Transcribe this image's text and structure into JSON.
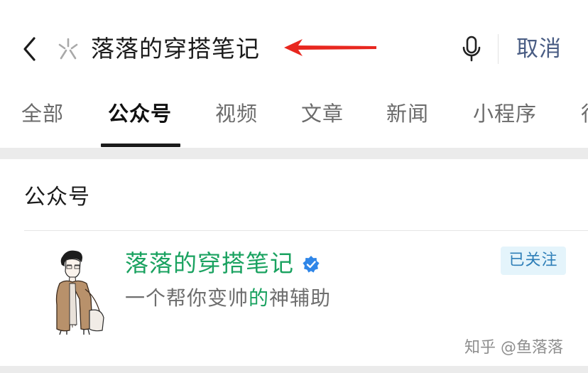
{
  "search": {
    "query": "落落的穿搭笔记",
    "cancel_label": "取消"
  },
  "tabs": [
    {
      "label": "全部",
      "active": false
    },
    {
      "label": "公众号",
      "active": true
    },
    {
      "label": "视频",
      "active": false
    },
    {
      "label": "文章",
      "active": false
    },
    {
      "label": "新闻",
      "active": false
    },
    {
      "label": "小程序",
      "active": false
    },
    {
      "label": "行",
      "active": false
    }
  ],
  "section": {
    "title": "公众号"
  },
  "result": {
    "name": "落落的穿搭笔记",
    "desc_before": "一个帮你变帅",
    "desc_highlight": "的",
    "desc_after": "神辅助",
    "follow_label": "已关注",
    "verified_icon": "verified-check-icon"
  },
  "watermark": "知乎 @鱼落落",
  "colors": {
    "brand_green": "#1aa260",
    "cancel_blue": "#4a5d84",
    "follow_badge_bg": "#e4f4fb",
    "follow_badge_text": "#2e7fb8",
    "verified_blue": "#2f86e8",
    "annotation_arrow": "#e8271f"
  }
}
